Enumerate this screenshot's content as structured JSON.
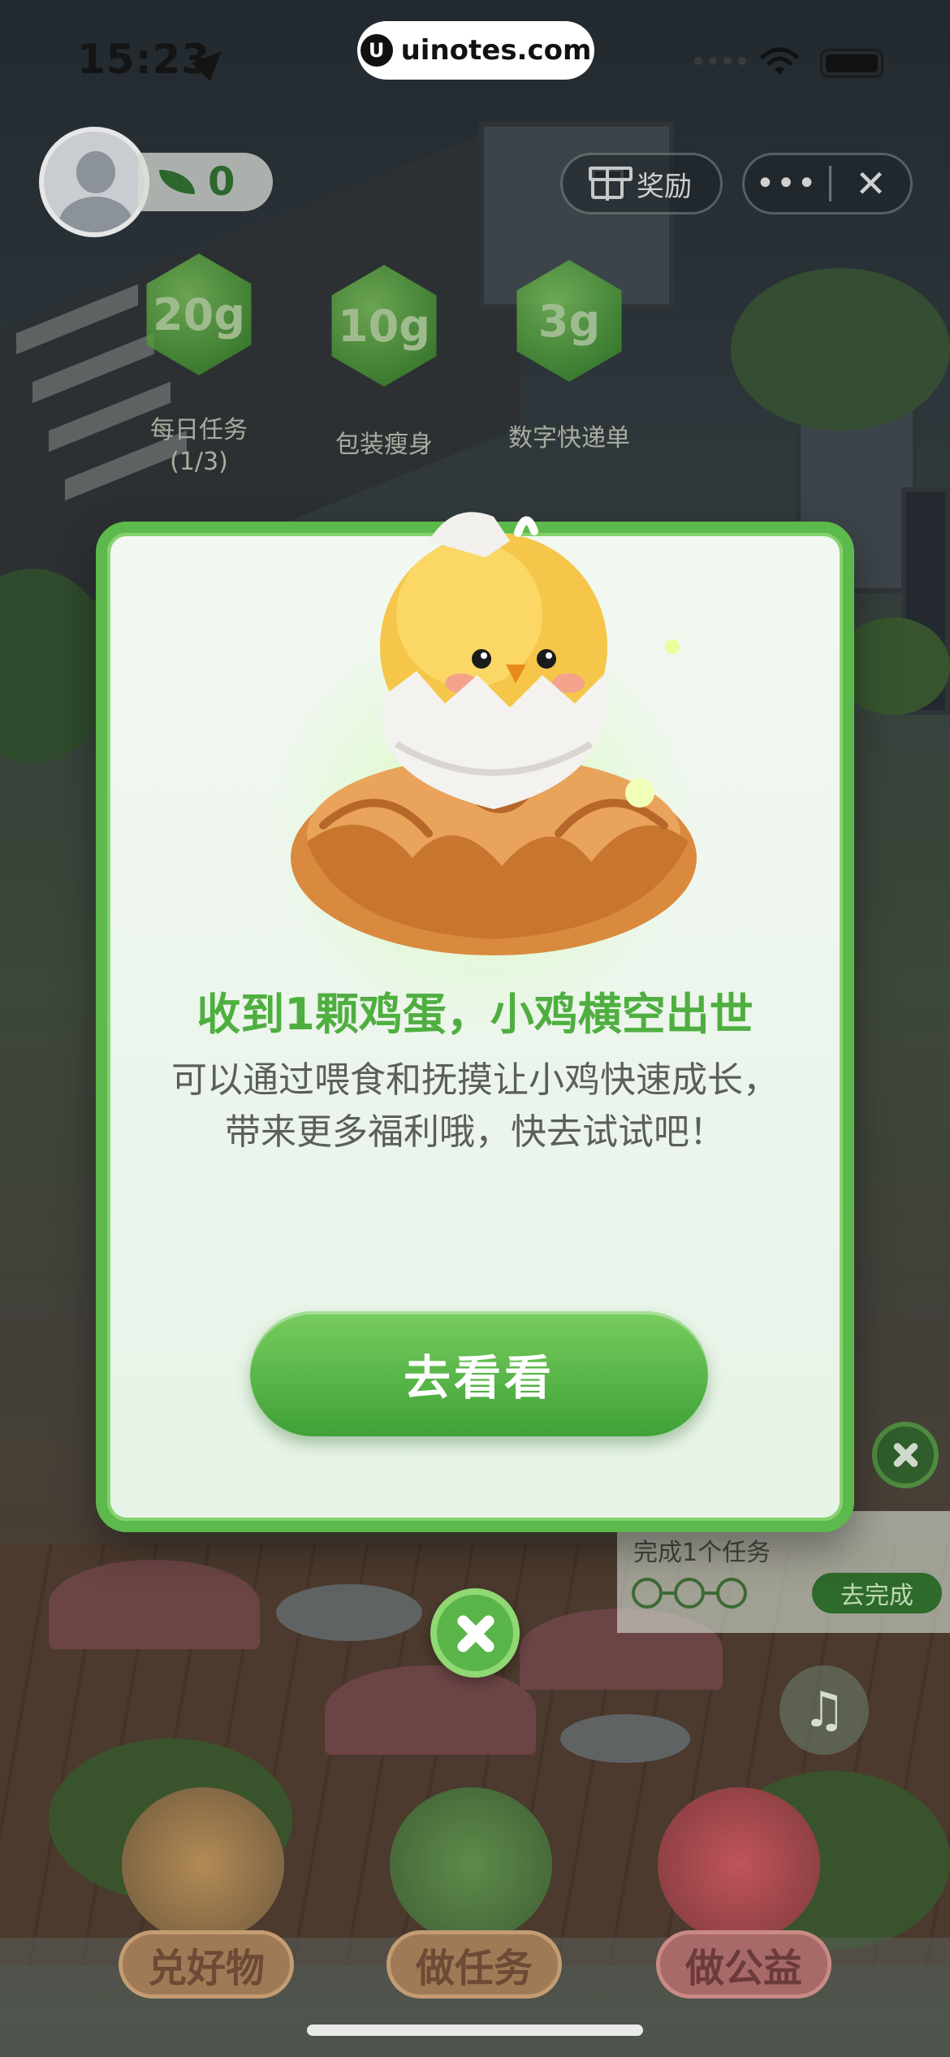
{
  "status_bar": {
    "time": "15:23",
    "url_logo": "U",
    "url": "uinotes.com"
  },
  "hud": {
    "energy_count": "0",
    "reward_label": "奖励",
    "more_glyph": "•••",
    "close_glyph": "✕"
  },
  "bubbles": [
    {
      "value": "20g",
      "label": "每日任务",
      "sublabel": "(1/3)"
    },
    {
      "value": "10g",
      "label": "包装瘦身",
      "sublabel": ""
    },
    {
      "value": "3g",
      "label": "数字快递单",
      "sublabel": ""
    }
  ],
  "modal": {
    "title": "收到1颗鸡蛋，小鸡横空出世",
    "description_line1": "可以通过喂食和抚摸让小鸡快速成长，",
    "description_line2": "带来更多福利哦，快去试试吧！",
    "button_label": "去看看"
  },
  "task_card": {
    "text": "完成1个任务",
    "go_label": "去完成"
  },
  "bottom_nav": {
    "items": [
      {
        "label": "兑好物"
      },
      {
        "label": "做任务"
      },
      {
        "label": "做公益"
      }
    ]
  },
  "colors": {
    "accent_green": "#5cb94b",
    "title_green": "#4fae40",
    "button_green": "#3fa138"
  },
  "icons": {
    "location": "location-arrow-icon",
    "wifi": "wifi-icon",
    "battery": "battery-icon",
    "leaf": "leaf-icon",
    "gift": "gift-icon",
    "close": "close-icon",
    "music": "music-off-icon"
  }
}
